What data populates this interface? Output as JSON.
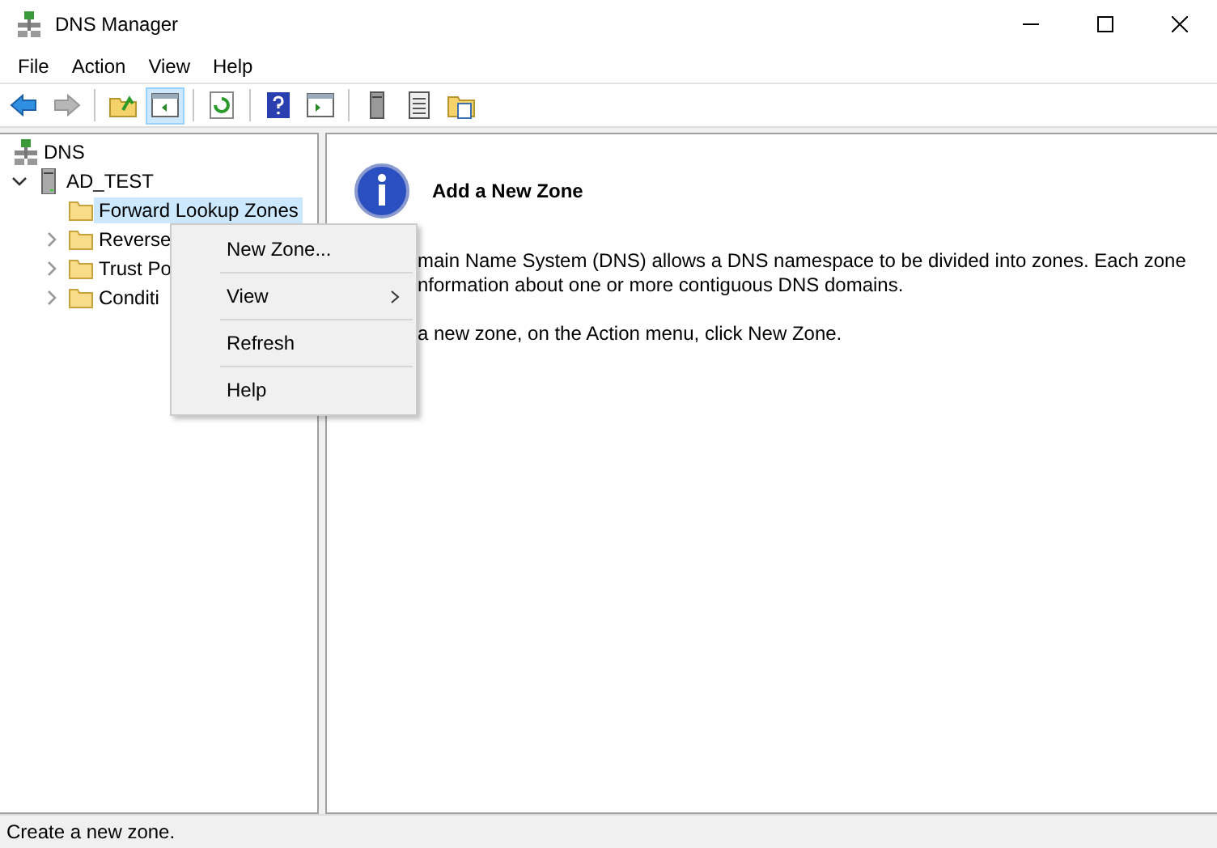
{
  "window": {
    "title": "DNS Manager"
  },
  "menu_bar": [
    "File",
    "Action",
    "View",
    "Help"
  ],
  "toolbar": [
    {
      "disabled": false,
      "pressed": false
    },
    {
      "disabled": true,
      "pressed": false
    },
    {
      "disabled": false,
      "pressed": false
    },
    {
      "disabled": false,
      "pressed": true
    },
    {
      "disabled": false,
      "pressed": false
    },
    {
      "disabled": false,
      "pressed": false
    },
    {
      "disabled": false,
      "pressed": false
    },
    {
      "disabled": false,
      "pressed": false
    },
    {
      "disabled": false,
      "pressed": false
    },
    {
      "disabled": false,
      "pressed": false
    }
  ],
  "tree": [
    {
      "label": "DNS",
      "kind": "root",
      "selected": false,
      "children": [
        {
          "label": "AD_TEST",
          "kind": "server",
          "expanded": true,
          "selected": false,
          "children": [
            {
              "label": "Forward Lookup Zones",
              "kind": "folder",
              "selected": true
            },
            {
              "label": "Reverse",
              "kind": "folder",
              "expanded": false,
              "selected": false
            },
            {
              "label": "Trust Po",
              "kind": "folder",
              "expanded": false,
              "selected": false
            },
            {
              "label": "Conditi",
              "kind": "folder",
              "expanded": false,
              "selected": false
            }
          ]
        }
      ]
    }
  ],
  "context_menu": [
    {
      "label": "New Zone...",
      "submenu": false
    },
    {
      "label": "View",
      "submenu": true
    },
    {
      "label": "Refresh",
      "submenu": false
    },
    {
      "label": "Help",
      "submenu": false
    }
  ],
  "details": {
    "heading": "Add a New Zone",
    "lines": [
      "main Name System (DNS) allows a DNS namespace to be divided into zones. Each zone",
      "nformation about one or more contiguous DNS domains.",
      "a new zone, on the Action menu, click New Zone."
    ]
  },
  "status_bar": "Create a new zone."
}
